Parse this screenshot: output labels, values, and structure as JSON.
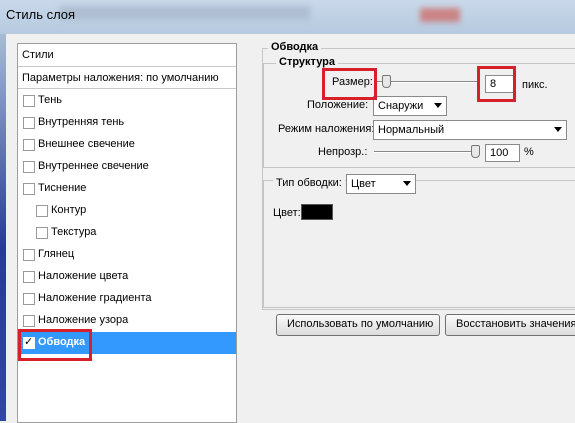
{
  "window": {
    "title": "Стиль слоя"
  },
  "styles_panel": {
    "header": "Стили",
    "blend_defaults": "Параметры наложения: по умолчанию",
    "items": [
      {
        "label": "Тень",
        "checked": false,
        "indent": false
      },
      {
        "label": "Внутренняя тень",
        "checked": false,
        "indent": false
      },
      {
        "label": "Внешнее свечение",
        "checked": false,
        "indent": false
      },
      {
        "label": "Внутреннее свечение",
        "checked": false,
        "indent": false
      },
      {
        "label": "Тиснение",
        "checked": false,
        "indent": false
      },
      {
        "label": "Контур",
        "checked": false,
        "indent": true
      },
      {
        "label": "Текстура",
        "checked": false,
        "indent": true
      },
      {
        "label": "Глянец",
        "checked": false,
        "indent": false
      },
      {
        "label": "Наложение цвета",
        "checked": false,
        "indent": false
      },
      {
        "label": "Наложение градиента",
        "checked": false,
        "indent": false
      },
      {
        "label": "Наложение узора",
        "checked": false,
        "indent": false
      },
      {
        "label": "Обводка",
        "checked": true,
        "indent": false,
        "selected": true
      }
    ]
  },
  "stroke": {
    "section_title": "Обводка",
    "structure": {
      "title": "Структура",
      "size_label": "Размер:",
      "size_value": "8",
      "size_unit": "пикс.",
      "position_label": "Положение:",
      "position_value": "Снаружи",
      "blend_mode_label": "Режим наложения:",
      "blend_mode_value": "Нормальный",
      "opacity_label": "Непрозр.:",
      "opacity_value": "100",
      "opacity_unit": "%",
      "opacity_fraction": 1.0
    },
    "fill": {
      "type_label": "Тип обводки:",
      "type_value": "Цвет",
      "color_label": "Цвет:",
      "color": "#000000"
    }
  },
  "buttons": {
    "make_default": "Использовать по умолчанию",
    "reset_default": "Восстановить значения по умолчанию"
  },
  "colors": {
    "selection": "#3399ff",
    "highlight": "#d8202a"
  }
}
